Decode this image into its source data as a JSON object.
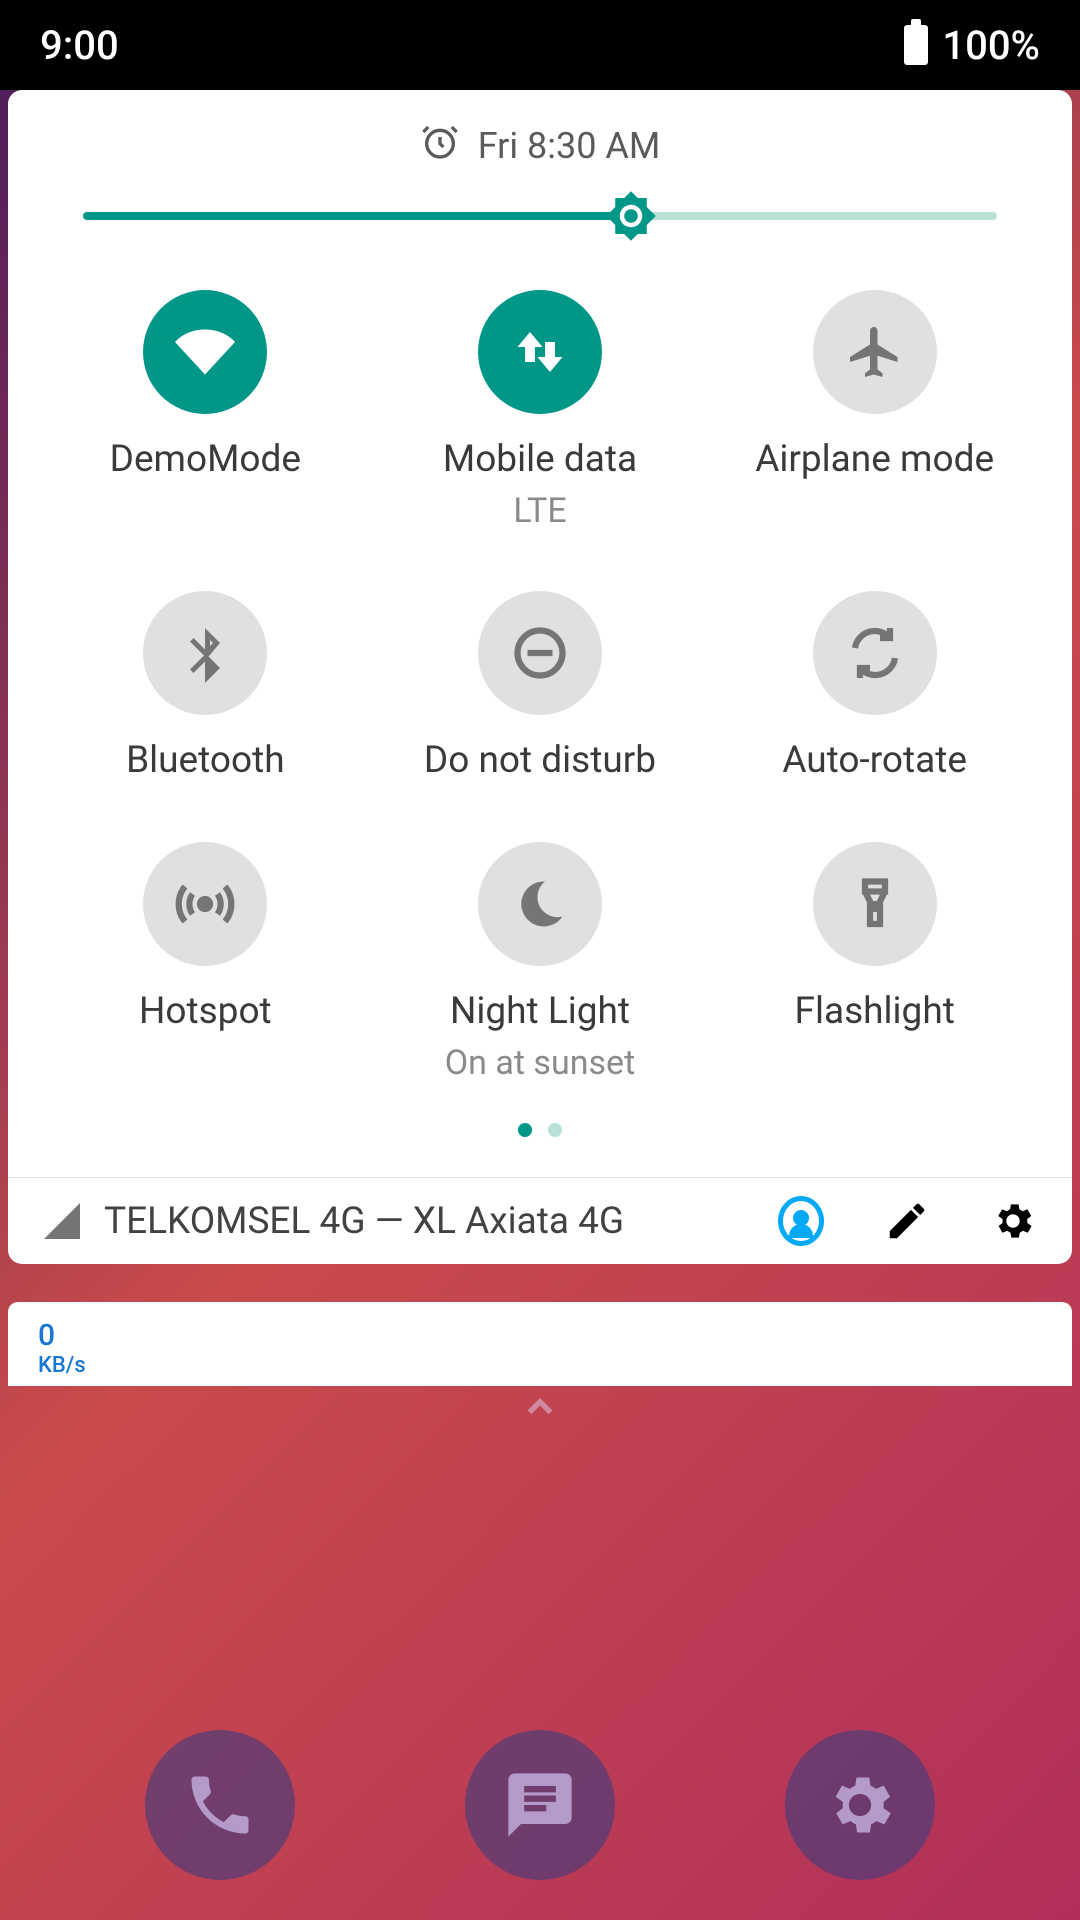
{
  "status": {
    "time": "9:00",
    "battery": "100%"
  },
  "panel": {
    "alarm": "Fri 8:30 AM",
    "brightness_percent": 60,
    "tiles": [
      {
        "label": "DemoMode",
        "sub": "",
        "active": true
      },
      {
        "label": "Mobile data",
        "sub": "LTE",
        "active": true
      },
      {
        "label": "Airplane mode",
        "sub": "",
        "active": false
      },
      {
        "label": "Bluetooth",
        "sub": "",
        "active": false
      },
      {
        "label": "Do not disturb",
        "sub": "",
        "active": false
      },
      {
        "label": "Auto-rotate",
        "sub": "",
        "active": false
      },
      {
        "label": "Hotspot",
        "sub": "",
        "active": false
      },
      {
        "label": "Night Light",
        "sub": "On at sunset",
        "active": false
      },
      {
        "label": "Flashlight",
        "sub": "",
        "active": false
      }
    ],
    "page_dots": 2,
    "page_active": 0,
    "carrier": "TELKOMSEL 4G — XL Axiata 4G"
  },
  "notification": {
    "value": "0",
    "unit": "KB/s"
  },
  "colors": {
    "accent": "#009688",
    "inactive": "#e0e0e0"
  }
}
